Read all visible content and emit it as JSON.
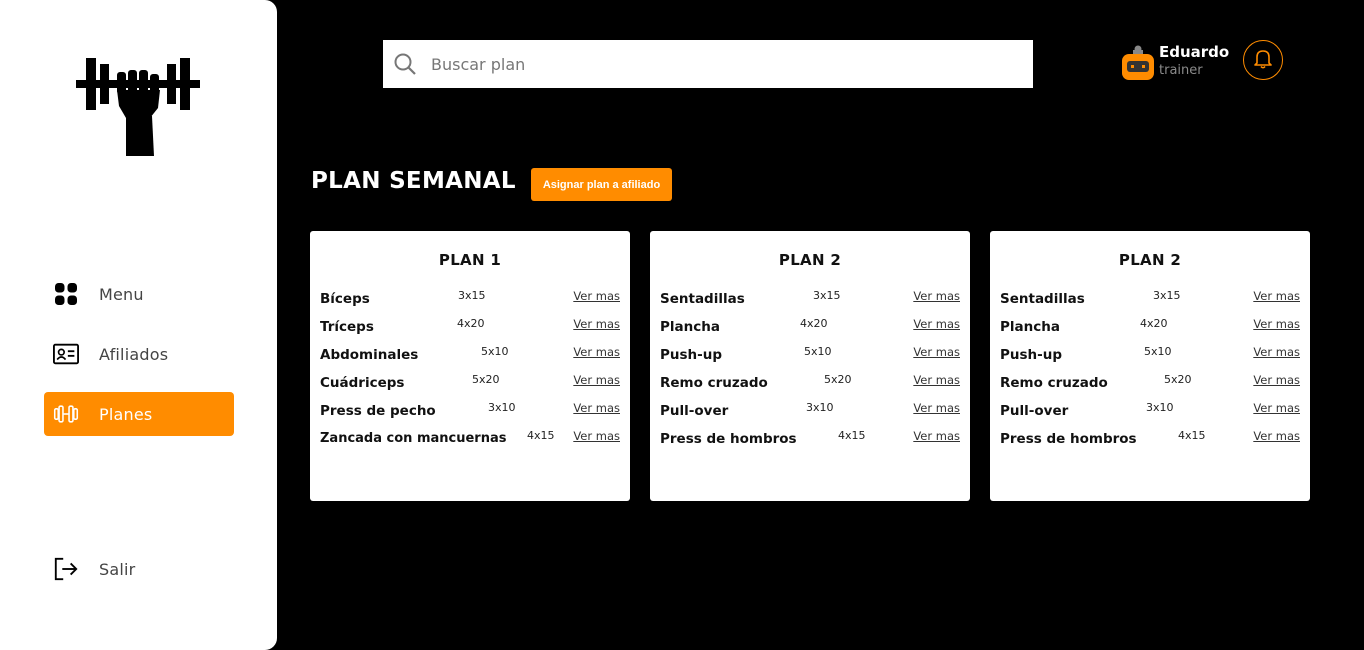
{
  "sidebar": {
    "items": [
      {
        "label": "Menu",
        "icon": "grid-icon",
        "active": false
      },
      {
        "label": "Afiliados",
        "icon": "id-card-icon",
        "active": false
      },
      {
        "label": "Planes",
        "icon": "dumbbell-icon",
        "active": true
      }
    ],
    "logout_label": "Salir"
  },
  "search": {
    "placeholder": "Buscar plan",
    "value": ""
  },
  "user": {
    "name": "Eduardo",
    "role": "trainer"
  },
  "page": {
    "title": "PLAN SEMANAL",
    "assign_label": "Asignar plan a afiliado"
  },
  "colors": {
    "accent": "#ff8c00",
    "background": "#000000",
    "card": "#ffffff"
  },
  "plans": [
    {
      "title": "PLAN 1",
      "rows": [
        {
          "exercise": "Bíceps",
          "reps": "3x15",
          "link": "Ver mas"
        },
        {
          "exercise": "Tríceps",
          "reps": "4x20",
          "link": "Ver mas"
        },
        {
          "exercise": "Abdominales",
          "reps": "5x10",
          "link": "Ver mas"
        },
        {
          "exercise": "Cuádriceps",
          "reps": "5x20",
          "link": "Ver mas"
        },
        {
          "exercise": "Press de pecho",
          "reps": "3x10",
          "link": "Ver mas"
        },
        {
          "exercise": "Zancada con mancuernas",
          "reps": "4x15",
          "link": "Ver mas"
        }
      ]
    },
    {
      "title": "PLAN 2",
      "rows": [
        {
          "exercise": "Sentadillas",
          "reps": "3x15",
          "link": "Ver mas"
        },
        {
          "exercise": "Plancha",
          "reps": "4x20",
          "link": "Ver mas"
        },
        {
          "exercise": "Push-up",
          "reps": "5x10",
          "link": "Ver mas"
        },
        {
          "exercise": "Remo cruzado",
          "reps": "5x20",
          "link": "Ver mas"
        },
        {
          "exercise": "Pull-over",
          "reps": "3x10",
          "link": "Ver mas"
        },
        {
          "exercise": "Press de hombros",
          "reps": "4x15",
          "link": "Ver mas"
        }
      ]
    },
    {
      "title": "PLAN 2",
      "rows": [
        {
          "exercise": "Sentadillas",
          "reps": "3x15",
          "link": "Ver mas"
        },
        {
          "exercise": "Plancha",
          "reps": "4x20",
          "link": "Ver mas"
        },
        {
          "exercise": "Push-up",
          "reps": "5x10",
          "link": "Ver mas"
        },
        {
          "exercise": "Remo cruzado",
          "reps": "5x20",
          "link": "Ver mas"
        },
        {
          "exercise": "Pull-over",
          "reps": "3x10",
          "link": "Ver mas"
        },
        {
          "exercise": "Press de hombros",
          "reps": "4x15",
          "link": "Ver mas"
        }
      ]
    }
  ]
}
